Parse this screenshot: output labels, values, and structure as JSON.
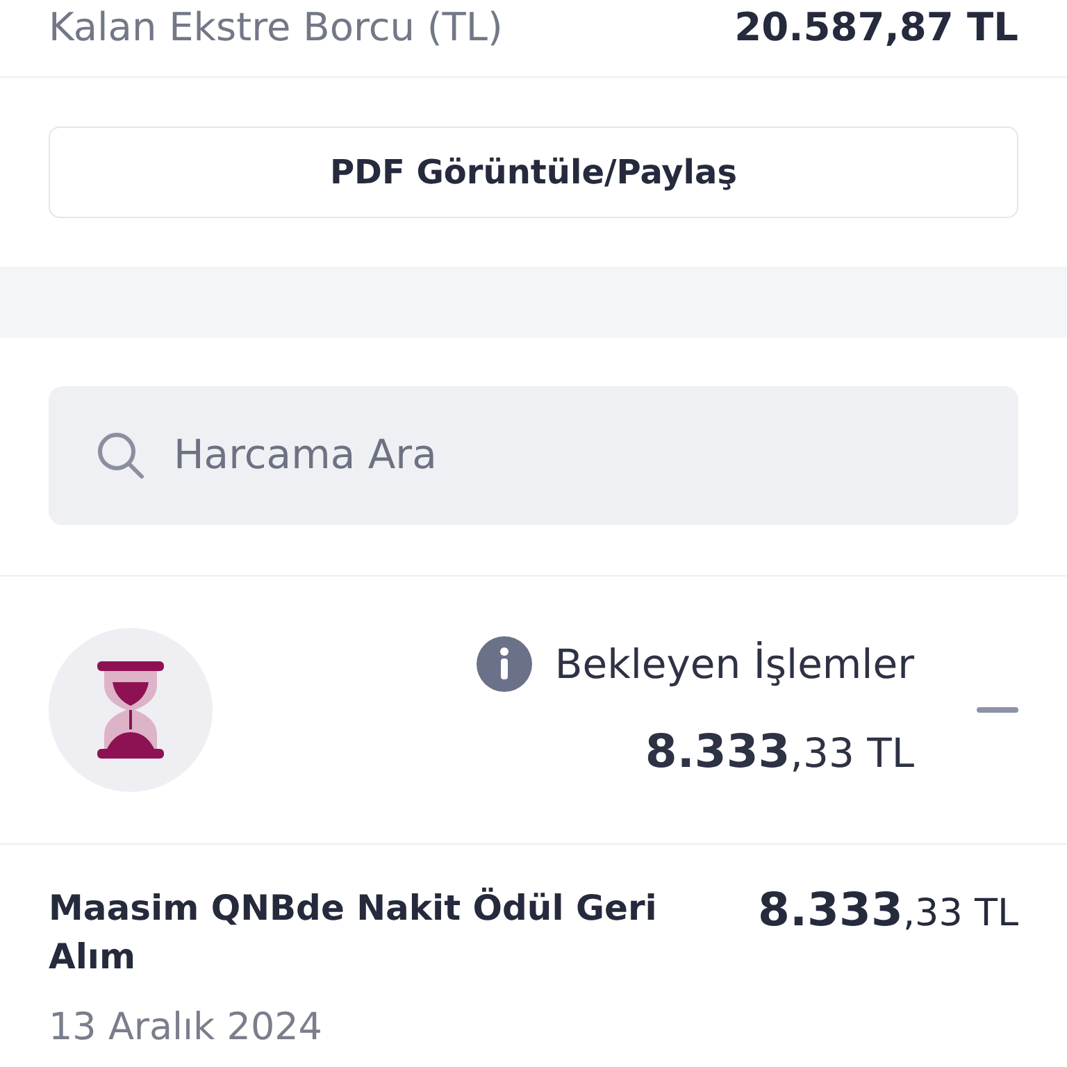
{
  "summary_row": {
    "label": "Kalan Ekstre Borcu (TL)",
    "value": "20.587,87 TL"
  },
  "pdf_button": {
    "label": "PDF Görüntüle/Paylaş"
  },
  "search": {
    "placeholder": "Harcama Ara"
  },
  "pending": {
    "title": "Bekleyen İşlemler",
    "amount": "**8.333**,33 TL",
    "expanded": true
  },
  "transactions": [
    {
      "description": "Maasim QNBde Nakit Ödül Geri Alım",
      "amount": "**8.333**,33 TL",
      "date": "13 Aralık 2024"
    }
  ]
}
